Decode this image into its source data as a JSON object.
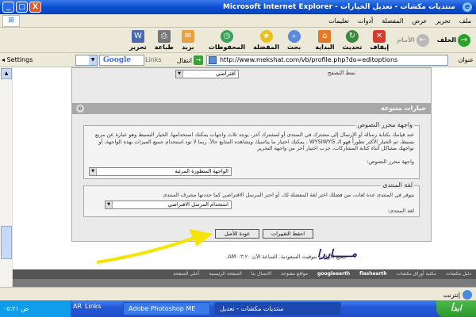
{
  "window": {
    "title": "منتديات مكشات - تعديل الخيارات - Microsoft Internet Explorer",
    "buttons": {
      "minimize": "_",
      "maximize": "□",
      "close": "X"
    }
  },
  "menu": [
    "ملف",
    "تحرير",
    "عرض",
    "المفضلة",
    "أدوات",
    "تعليمات"
  ],
  "toolbar": {
    "back": "الخلف",
    "forward": "الأمام",
    "stop": "إيقاف",
    "refresh": "تحديث",
    "home": "البداية",
    "search": "بحث",
    "favorites": "المفضلة",
    "history": "المحفوظات",
    "mail": "بريد",
    "print": "طباعة",
    "edit": "تحرير"
  },
  "address": {
    "label": "عنوان",
    "url": "http://www.mekshat.com/vb/profile.php?do=editoptions",
    "go": "انتقال",
    "links": "Links",
    "google": "Google",
    "settings": "Settings"
  },
  "page": {
    "top_select": "افتراضي",
    "top_hint": "نمط التصفح",
    "section_title": "خيارات متنوعة",
    "editor": {
      "legend": "واجهة محرر النصوص",
      "description": "عند قيامك بكتابة رسالة أو الإرسال إلى مشترك في المنتدى أو لمشترك آخر، يوجد ثلاث واجهات يمكنك استخدامها. الخيار البسيط وهو عبارة عن مربع بسيط، ثم الخيار الأكثر تطوراً فهو الـ WYSIWYG ، يمكنك اختيار ما يناسبك ويشاهده المتابع حالاً. ربما لا تود استخدام جميع الميزات بهذه الواجهة، أو تواجهك مشاكل أثناء كتابة المشاركات، جرب اختيار آخر من واجهة التحرير",
      "label": "واجهة محرر النصوص:",
      "value": "الواجهة المتطورة المرئية"
    },
    "language": {
      "legend": "لغة المنتدى",
      "description": "يتوفر في المنتدى عدة لغات، من فضلك اختر لغة المفضلة لك، أو اختر المرسل الافتراضي كما حددتها مشرف المنتدى",
      "label": "لغة المنتدى:",
      "value": "استخدام المرسل الافتراضي"
    },
    "save_button": "احفظ التغييرات",
    "reset_button": "عودة للأصل",
    "timezone": "جميع الأوقات بتوقيت السعودية. الساعة الآن ٠٣:٢٠ AM.",
    "signature": "مــــــاررا",
    "footer_links": [
      "دليل مكشات",
      "مكتبة أوراق مكشات",
      "googleearth",
      "flashearth",
      "مواقع مفتوحة",
      "الاتصال بنا",
      "الصفحة الرئيسية",
      "أعلى الصفحة"
    ]
  },
  "statusbar": {
    "zone": "إنترنت"
  },
  "taskbar": {
    "start": "ابدأ",
    "tasks": [
      "منتديات مكشات - تعديل",
      "Adobe Photoshop ME"
    ],
    "clock": "ص ٠٥:٢١",
    "lang": "AR",
    "links": "Links"
  },
  "colors": {
    "title_bar": "#0a4fd3",
    "section_header": "#a8a8a8",
    "arrow": "#f5e400",
    "taskbar": "#2458d8"
  }
}
